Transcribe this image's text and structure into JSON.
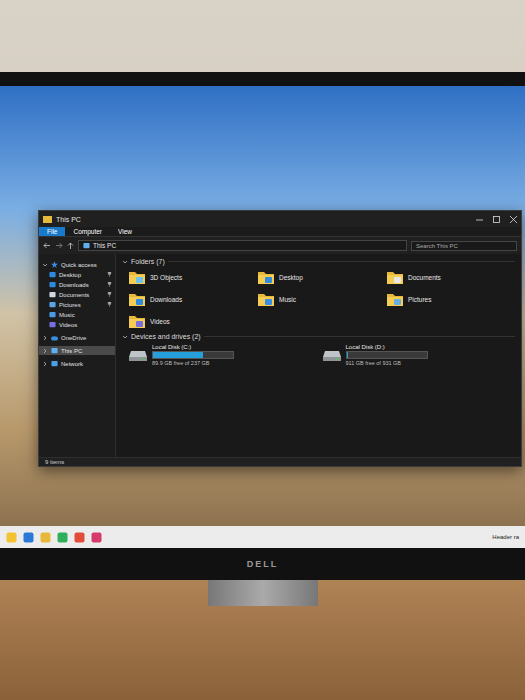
{
  "window": {
    "title": "This PC"
  },
  "ribbon_tabs": [
    {
      "label": "File",
      "selected": true
    },
    {
      "label": "Computer",
      "selected": false
    },
    {
      "label": "View",
      "selected": false
    }
  ],
  "address": "This PC",
  "search": {
    "placeholder": "Search This PC"
  },
  "sidebar": {
    "items": [
      {
        "label": "Quick access",
        "kind": "group",
        "expanded": true,
        "pinned": false,
        "selected": false
      },
      {
        "label": "Desktop",
        "kind": "child",
        "expanded": false,
        "pinned": true,
        "selected": false
      },
      {
        "label": "Downloads",
        "kind": "child",
        "expanded": false,
        "pinned": true,
        "selected": false
      },
      {
        "label": "Documents",
        "kind": "child",
        "expanded": false,
        "pinned": true,
        "selected": false
      },
      {
        "label": "Pictures",
        "kind": "child",
        "expanded": false,
        "pinned": true,
        "selected": false
      },
      {
        "label": "Music",
        "kind": "child",
        "expanded": false,
        "pinned": false,
        "selected": false
      },
      {
        "label": "Videos",
        "kind": "child",
        "expanded": false,
        "pinned": false,
        "selected": false
      },
      {
        "label": "OneDrive",
        "kind": "group",
        "expanded": false,
        "pinned": false,
        "selected": false
      },
      {
        "label": "This PC",
        "kind": "group",
        "expanded": false,
        "pinned": false,
        "selected": true
      },
      {
        "label": "Network",
        "kind": "group",
        "expanded": false,
        "pinned": false,
        "selected": false
      }
    ]
  },
  "folders": {
    "heading": "Folders (7)",
    "items": [
      "3D Objects",
      "Desktop",
      "Documents",
      "Downloads",
      "Music",
      "Pictures",
      "Videos"
    ]
  },
  "drives": {
    "heading": "Devices and drives (2)",
    "items": [
      {
        "name": "Local Disk (C:)",
        "free": "89.9 GB free of 237 GB",
        "level": 0.62
      },
      {
        "name": "Local Disk (D:)",
        "free": "911 GB free of 931 GB",
        "level": 0.02
      }
    ]
  },
  "status_bar": "9 items",
  "taskbar": {
    "tray_text": "Header ra"
  },
  "monitor": {
    "brand": "DELL"
  }
}
